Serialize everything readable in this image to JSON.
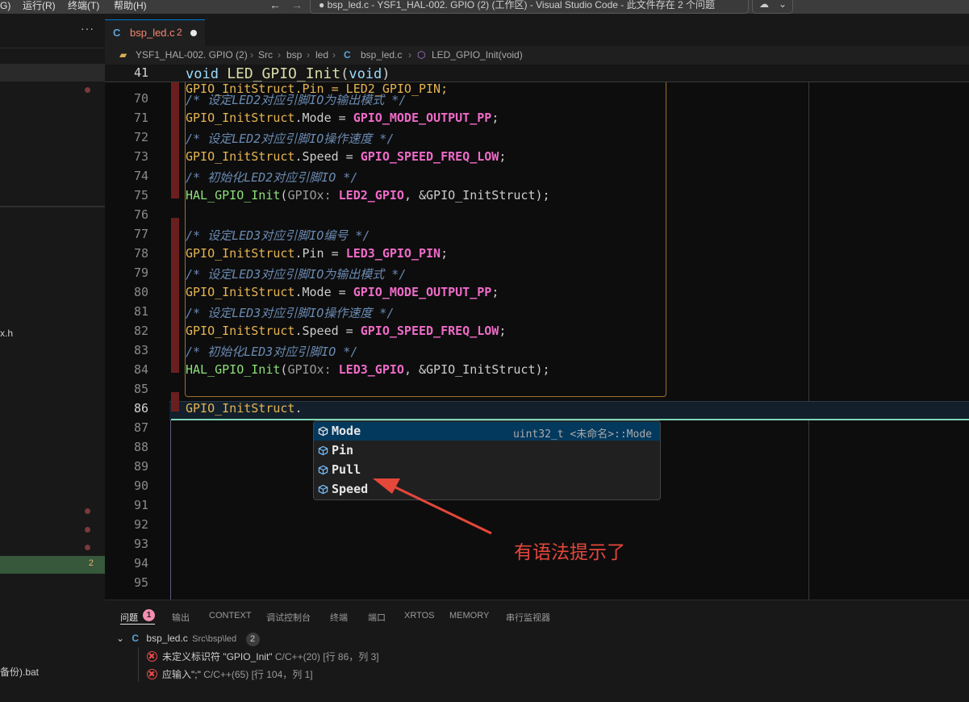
{
  "titlebar": {
    "menu": [
      "G)",
      "运行(R)",
      "终端(T)",
      "帮助(H)"
    ],
    "window_title": "● bsp_led.c - YSF1_HAL-002. GPIO (2) (工作区) - Visual Studio Code - 此文件存在 2 个问题"
  },
  "sidebar": {
    "more": "···",
    "file_h": "x.h",
    "active_badge": "2",
    "file_bat": "备份).bat"
  },
  "tab": {
    "icon": "C",
    "name": "bsp_led.c",
    "problems": "2"
  },
  "breadcrumb": [
    "YSF1_HAL-002. GPIO (2)",
    "Src",
    "bsp",
    "led",
    "bsp_led.c",
    "LED_GPIO_Init(void)"
  ],
  "sticky": {
    "line": "41",
    "text_kw": "void",
    "text_fn": "LED_GPIO_Init",
    "text_paren_open": "(",
    "text_arg": "void",
    "text_paren_close": ")"
  },
  "code_lines": [
    {
      "n": "70",
      "c": "/* 设定LED2对应引脚IO为输出模式 */"
    },
    {
      "n": "71",
      "a": "GPIO_InitStruct",
      "b": ".Mode = ",
      "m": "GPIO_MODE_OUTPUT_PP",
      "e": ";"
    },
    {
      "n": "72",
      "c": "/* 设定LED2对应引脚IO操作速度 */"
    },
    {
      "n": "73",
      "a": "GPIO_InitStruct",
      "b": ".Speed = ",
      "m": "GPIO_SPEED_FREQ_LOW",
      "e": ";"
    },
    {
      "n": "74",
      "c": "/* 初始化LED2对应引脚IO */"
    },
    {
      "n": "75",
      "f": "HAL_GPIO_Init",
      "h": "GPIOx:",
      "m": "LED2_GPIO",
      "e": ", &GPIO_InitStruct);"
    },
    {
      "n": "76"
    },
    {
      "n": "77",
      "c": "/* 设定LED3对应引脚IO编号 */"
    },
    {
      "n": "78",
      "a": "GPIO_InitStruct",
      "b": ".Pin = ",
      "m": "LED3_GPIO_PIN",
      "e": ";"
    },
    {
      "n": "79",
      "c": "/* 设定LED3对应引脚IO为输出模式 */"
    },
    {
      "n": "80",
      "a": "GPIO_InitStruct",
      "b": ".Mode = ",
      "m": "GPIO_MODE_OUTPUT_PP",
      "e": ";"
    },
    {
      "n": "81",
      "c": "/* 设定LED3对应引脚IO操作速度 */"
    },
    {
      "n": "82",
      "a": "GPIO_InitStruct",
      "b": ".Speed = ",
      "m": "GPIO_SPEED_FREQ_LOW",
      "e": ";"
    },
    {
      "n": "83",
      "c": "/* 初始化LED3对应引脚IO */"
    },
    {
      "n": "84",
      "f": "HAL_GPIO_Init",
      "h": "GPIOx:",
      "m": "LED3_GPIO",
      "e": ", &GPIO_InitStruct);"
    },
    {
      "n": "85"
    },
    {
      "n": "86",
      "a": "GPIO_InitStruct",
      "b": "."
    },
    {
      "n": "87"
    },
    {
      "n": "88"
    },
    {
      "n": "89"
    },
    {
      "n": "90"
    },
    {
      "n": "91"
    },
    {
      "n": "92"
    },
    {
      "n": "93"
    },
    {
      "n": "94"
    },
    {
      "n": "95"
    }
  ],
  "partial_top_line": "GPIO_InitStruct.Pin = LED2_GPIO_PIN;",
  "suggest": {
    "items": [
      "Mode",
      "Pin",
      "Pull",
      "Speed"
    ],
    "selected_detail": "uint32_t <未命名>::Mode",
    "icon": "field-cube-icon"
  },
  "annotation": "有语法提示了",
  "panel": {
    "tabs": [
      "问题",
      "输出",
      "CONTEXT",
      "调试控制台",
      "终端",
      "端口",
      "XRTOS",
      "MEMORY",
      "串行监视器"
    ],
    "problem_badge": "1",
    "file": "bsp_led.c",
    "file_path": "Src\\bsp\\led",
    "file_count": "2",
    "problems": [
      {
        "msg": "未定义标识符 \"GPIO_Init\"",
        "src": "C/C++(20)",
        "loc": "[行 86，列 3]"
      },
      {
        "msg": "应输入\";\"",
        "src": "C/C++(65)",
        "loc": "[行 104，列 1]"
      }
    ]
  },
  "colors": {
    "accent": "#0078d4",
    "error": "#f14c4c",
    "annotation": "#e5473a"
  }
}
